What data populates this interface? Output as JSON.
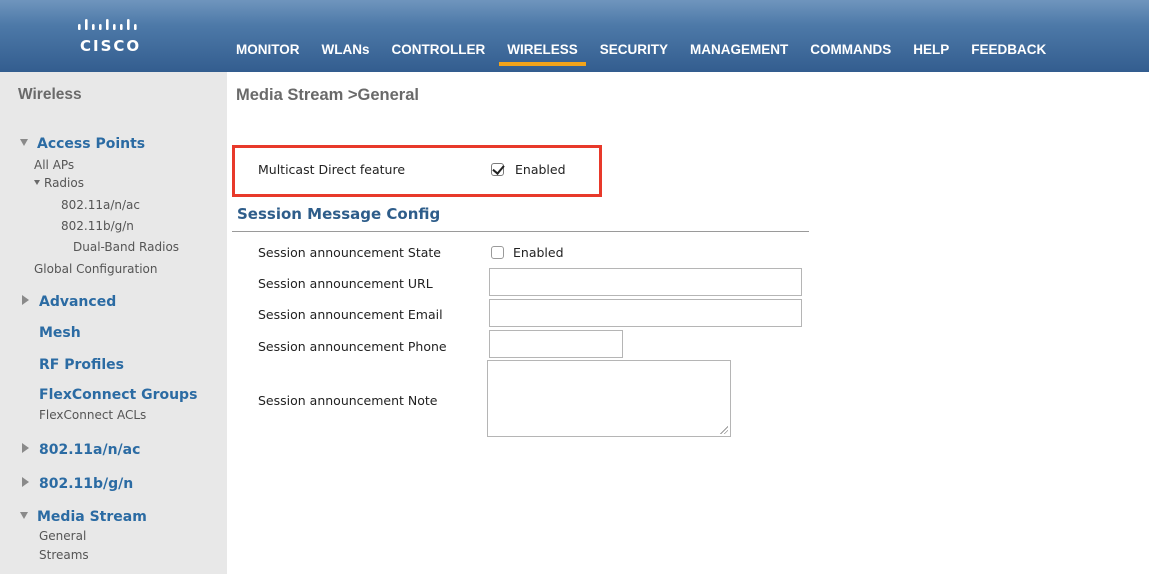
{
  "brand": {
    "name": "CISCO"
  },
  "nav": {
    "items": [
      {
        "label": "MONITOR"
      },
      {
        "label": "WLANs"
      },
      {
        "label": "CONTROLLER"
      },
      {
        "label": "WIRELESS",
        "active": true
      },
      {
        "label": "SECURITY"
      },
      {
        "label": "MANAGEMENT"
      },
      {
        "label": "COMMANDS"
      },
      {
        "label": "HELP"
      },
      {
        "label": "FEEDBACK"
      }
    ],
    "active_color": "#f2a31b"
  },
  "sidebar": {
    "title": "Wireless",
    "access_points": "Access Points",
    "all_aps": "All APs",
    "radios": "Radios",
    "radio_a": "802.11a/n/ac",
    "radio_b": "802.11b/g/n",
    "dual_band": "Dual-Band Radios",
    "global_config": "Global Configuration",
    "advanced": "Advanced",
    "mesh": "Mesh",
    "rf_profiles": "RF Profiles",
    "flexconnect_groups": "FlexConnect Groups",
    "flexconnect_acls": "FlexConnect ACLs",
    "section_a": "802.11a/n/ac",
    "section_b": "802.11b/g/n",
    "media_stream": "Media Stream",
    "general": "General",
    "streams": "Streams"
  },
  "main": {
    "title": "Media Stream >General",
    "multicast": {
      "label": "Multicast Direct feature",
      "checkbox_label": "Enabled",
      "checked": true
    },
    "session": {
      "title": "Session Message Config",
      "state_label": "Session announcement State",
      "state_checkbox_label": "Enabled",
      "state_checked": false,
      "url_label": "Session announcement URL",
      "url_value": "",
      "email_label": "Session announcement Email",
      "email_value": "",
      "phone_label": "Session announcement Phone",
      "phone_value": "",
      "note_label": "Session announcement Note",
      "note_value": ""
    }
  },
  "colors": {
    "highlight_border": "#e8392a",
    "header": "#4d79a8",
    "link_blue": "#2b6ba3"
  }
}
